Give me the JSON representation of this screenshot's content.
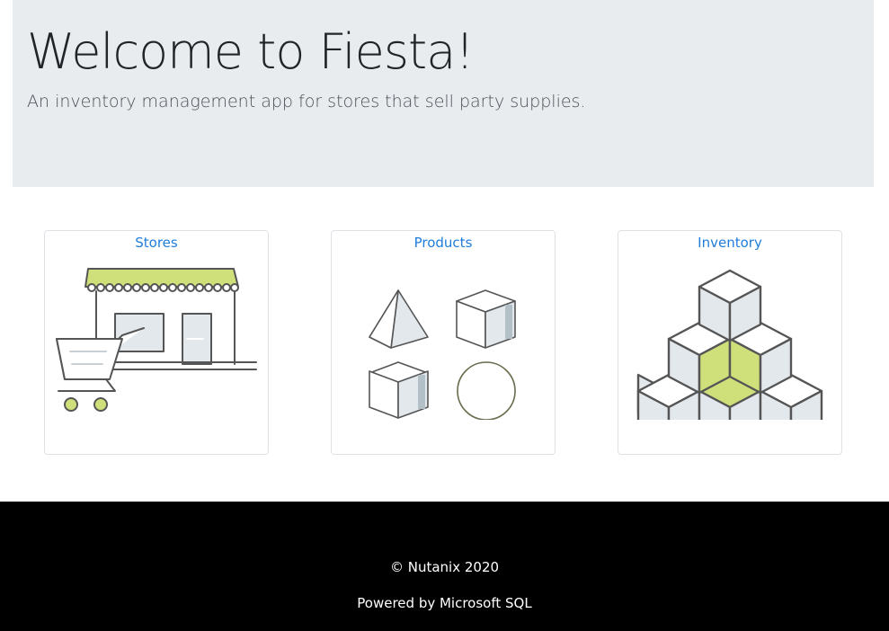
{
  "hero": {
    "title": "Welcome to Fiesta!",
    "lead": "An inventory management app for stores that sell party supplies.",
    "background": "#e9ecef"
  },
  "cards": [
    {
      "label": "Stores",
      "illustration": "storefront-cart-icon"
    },
    {
      "label": "Products",
      "illustration": "shapes-icon"
    },
    {
      "label": "Inventory",
      "illustration": "stacked-cubes-icon"
    }
  ],
  "footer": {
    "copyright": "© Nutanix 2020",
    "powered_by": "Powered by Microsoft SQL",
    "background": "#000000"
  },
  "colors": {
    "link": "#1f7ddb",
    "accent_green": "#cfe07a",
    "line": "#555555",
    "fill_light": "#e3e8ec"
  }
}
